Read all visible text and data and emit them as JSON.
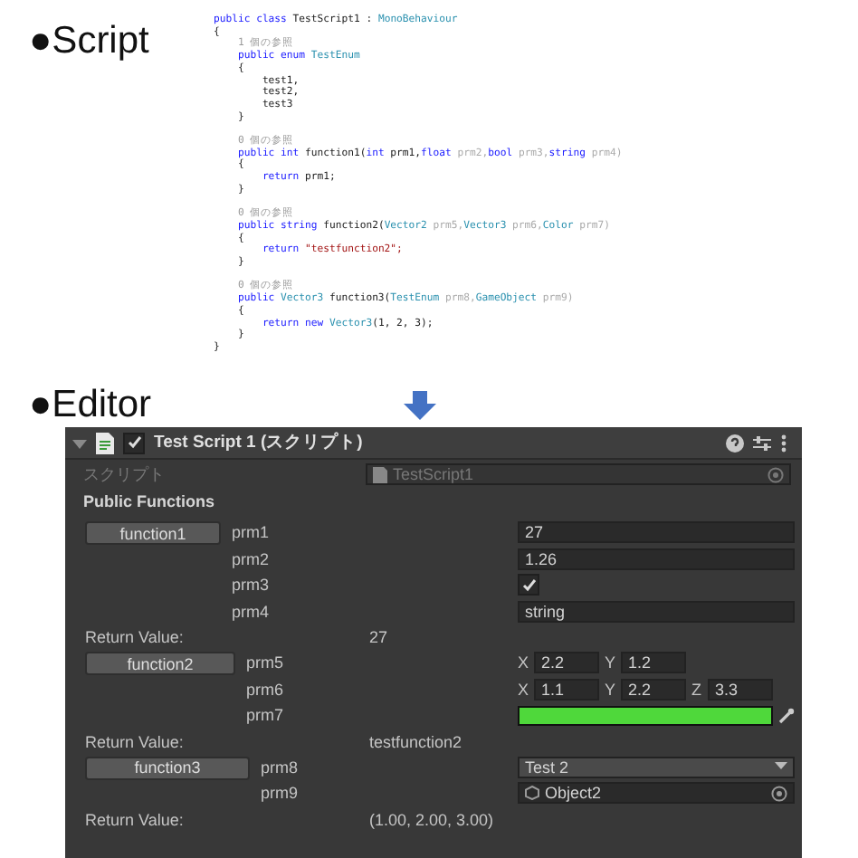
{
  "script_heading": "●Script",
  "code_lines": [
    {
      "blank_before": false,
      "tokens": [
        {
          "t": "public class",
          "kind": "kw"
        },
        {
          "t": " TestScript1 : ",
          "kind": "plain"
        },
        {
          "t": "MonoBehaviour",
          "kind": "type"
        }
      ]
    },
    {
      "blank_before": false,
      "tokens": [
        {
          "t": "{",
          "kind": "plain"
        }
      ]
    },
    {
      "blank_before": false,
      "tokens": [
        {
          "t": "    1 個の参照",
          "kind": "hint"
        }
      ]
    },
    {
      "blank_before": false,
      "tokens": [
        {
          "t": "    public enum ",
          "kind": "kw"
        },
        {
          "t": "TestEnum",
          "kind": "type"
        }
      ]
    },
    {
      "blank_before": false,
      "tokens": [
        {
          "t": "    {",
          "kind": "plain"
        }
      ]
    },
    {
      "blank_before": false,
      "tokens": [
        {
          "t": "        test1,",
          "kind": "plain"
        }
      ]
    },
    {
      "blank_before": false,
      "tokens": [
        {
          "t": "        test2,",
          "kind": "plain"
        }
      ]
    },
    {
      "blank_before": false,
      "tokens": [
        {
          "t": "        test3",
          "kind": "plain"
        }
      ]
    },
    {
      "blank_before": false,
      "tokens": [
        {
          "t": "    }",
          "kind": "plain"
        }
      ]
    },
    {
      "blank_before": true,
      "tokens": [
        {
          "t": "    0 個の参照",
          "kind": "hint"
        }
      ]
    },
    {
      "blank_before": false,
      "tokens": [
        {
          "t": "    public int",
          "kind": "kw"
        },
        {
          "t": " function1(",
          "kind": "plain"
        },
        {
          "t": "int",
          "kind": "kw"
        },
        {
          "t": " prm1,",
          "kind": "plain"
        },
        {
          "t": "float",
          "kind": "kw"
        },
        {
          "t": " prm2,",
          "kind": "unused"
        },
        {
          "t": "bool",
          "kind": "kw"
        },
        {
          "t": " prm3,",
          "kind": "unused"
        },
        {
          "t": "string",
          "kind": "kw"
        },
        {
          "t": " prm4)",
          "kind": "unused"
        }
      ]
    },
    {
      "blank_before": false,
      "tokens": [
        {
          "t": "    {",
          "kind": "plain"
        }
      ]
    },
    {
      "blank_before": false,
      "tokens": [
        {
          "t": "        return",
          "kind": "kw"
        },
        {
          "t": " prm1;",
          "kind": "plain"
        }
      ]
    },
    {
      "blank_before": false,
      "tokens": [
        {
          "t": "    }",
          "kind": "plain"
        }
      ]
    },
    {
      "blank_before": true,
      "tokens": [
        {
          "t": "    0 個の参照",
          "kind": "hint"
        }
      ]
    },
    {
      "blank_before": false,
      "tokens": [
        {
          "t": "    public string",
          "kind": "kw"
        },
        {
          "t": " function2(",
          "kind": "plain"
        },
        {
          "t": "Vector2",
          "kind": "type"
        },
        {
          "t": " prm5,",
          "kind": "unused"
        },
        {
          "t": "Vector3",
          "kind": "type"
        },
        {
          "t": " prm6,",
          "kind": "unused"
        },
        {
          "t": "Color",
          "kind": "type"
        },
        {
          "t": " prm7)",
          "kind": "unused"
        }
      ]
    },
    {
      "blank_before": false,
      "tokens": [
        {
          "t": "    {",
          "kind": "plain"
        }
      ]
    },
    {
      "blank_before": false,
      "tokens": [
        {
          "t": "        return ",
          "kind": "kw"
        },
        {
          "t": "\"testfunction2\";",
          "kind": "str"
        }
      ]
    },
    {
      "blank_before": false,
      "tokens": [
        {
          "t": "    }",
          "kind": "plain"
        }
      ]
    },
    {
      "blank_before": true,
      "tokens": [
        {
          "t": "    0 個の参照",
          "kind": "hint"
        }
      ]
    },
    {
      "blank_before": false,
      "tokens": [
        {
          "t": "    public ",
          "kind": "kw"
        },
        {
          "t": "Vector3",
          "kind": "type"
        },
        {
          "t": " function3(",
          "kind": "plain"
        },
        {
          "t": "TestEnum",
          "kind": "type"
        },
        {
          "t": " prm8,",
          "kind": "unused"
        },
        {
          "t": "GameObject",
          "kind": "type"
        },
        {
          "t": " prm9)",
          "kind": "unused"
        }
      ]
    },
    {
      "blank_before": false,
      "tokens": [
        {
          "t": "    {",
          "kind": "plain"
        }
      ]
    },
    {
      "blank_before": false,
      "tokens": [
        {
          "t": "        return new ",
          "kind": "kw"
        },
        {
          "t": "Vector3",
          "kind": "type"
        },
        {
          "t": "(1, 2, 3);",
          "kind": "plain"
        }
      ]
    },
    {
      "blank_before": false,
      "tokens": [
        {
          "t": "    }",
          "kind": "plain"
        }
      ]
    },
    {
      "blank_before": false,
      "tokens": [
        {
          "t": "}",
          "kind": "plain"
        }
      ]
    }
  ],
  "editor_heading": "●Editor",
  "component": {
    "title": "Test Script 1 (スクリプト)",
    "enabled": true,
    "expanded": true,
    "script_label": "スクリプト",
    "script_value": "TestScript1",
    "section": "Public Functions",
    "functions": [
      {
        "button": "function1",
        "params": [
          {
            "label": "prm1",
            "kind": "text",
            "value": "27"
          },
          {
            "label": "prm2",
            "kind": "text",
            "value": "1.26"
          },
          {
            "label": "prm3",
            "kind": "bool",
            "checked": true
          },
          {
            "label": "prm4",
            "kind": "text",
            "value": "string"
          }
        ],
        "return_label": "Return Value:",
        "return_value": "27"
      },
      {
        "button": "function2",
        "params": [
          {
            "label": "prm5",
            "kind": "vector",
            "components": [
              {
                "axis": "X",
                "value": "2.2"
              },
              {
                "axis": "Y",
                "value": "1.2"
              }
            ]
          },
          {
            "label": "prm6",
            "kind": "vector",
            "components": [
              {
                "axis": "X",
                "value": "1.1"
              },
              {
                "axis": "Y",
                "value": "2.2"
              },
              {
                "axis": "Z",
                "value": "3.3"
              }
            ]
          },
          {
            "label": "prm7",
            "kind": "color",
            "color": "#4fd83b"
          }
        ],
        "return_label": "Return Value:",
        "return_value": "testfunction2"
      },
      {
        "button": "function3",
        "params": [
          {
            "label": "prm8",
            "kind": "enum",
            "value": "Test 2"
          },
          {
            "label": "prm9",
            "kind": "object",
            "value": "Object2"
          }
        ],
        "return_label": "Return Value:",
        "return_value": "(1.00, 2.00, 3.00)"
      }
    ]
  }
}
